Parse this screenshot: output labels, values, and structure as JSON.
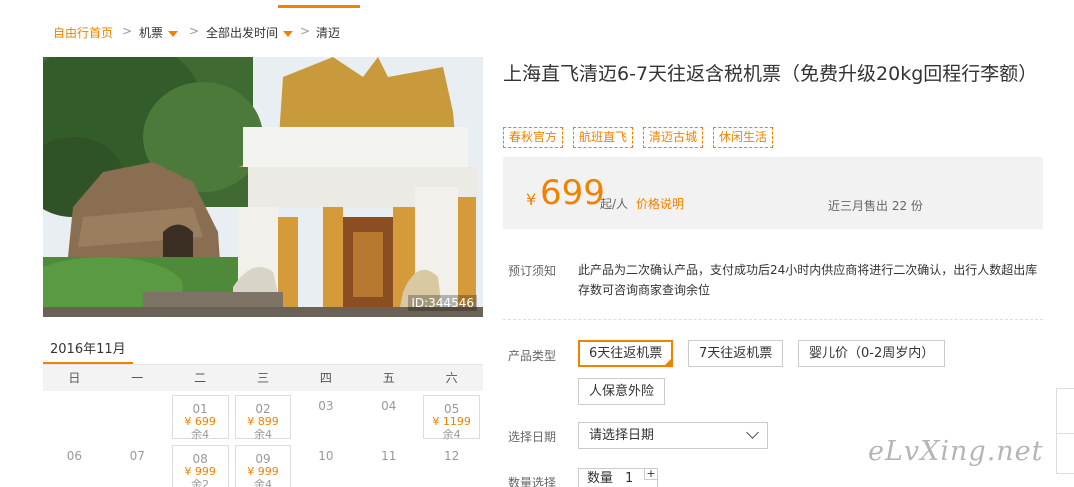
{
  "breadcrumb": {
    "home": "自由行首页",
    "flight": "机票",
    "departure": "全部出发时间",
    "destination": "清迈",
    "separator": ">"
  },
  "photo": {
    "id_label": "ID:344546"
  },
  "calendar": {
    "month": "2016年11月",
    "weekdays": [
      "日",
      "一",
      "二",
      "三",
      "四",
      "五",
      "六"
    ],
    "rows": [
      [
        {
          "day": ""
        },
        {
          "day": ""
        },
        {
          "day": "01",
          "price": "¥ 699",
          "stock": "余4"
        },
        {
          "day": "02",
          "price": "¥ 899",
          "stock": "余4"
        },
        {
          "day": "03"
        },
        {
          "day": "04"
        },
        {
          "day": "05",
          "price": "¥ 1199",
          "stock": "余4"
        }
      ],
      [
        {
          "day": "06"
        },
        {
          "day": "07"
        },
        {
          "day": "08",
          "price": "¥ 999",
          "stock": "余2"
        },
        {
          "day": "09",
          "price": "¥ 999",
          "stock": "余4"
        },
        {
          "day": "10"
        },
        {
          "day": "11"
        },
        {
          "day": "12"
        }
      ]
    ]
  },
  "product": {
    "title": "上海直飞清迈6-7天往返含税机票（免费升级20kg回程行李额）",
    "tags": [
      "春秋官方",
      "航班直飞",
      "清迈古城",
      "休闲生活"
    ],
    "currency": "¥",
    "price": "699",
    "price_unit": "起/人",
    "price_note": "价格说明",
    "sold": "近三月售出 22 份"
  },
  "booking": {
    "notice_label": "预订须知",
    "notice_text": "此产品为二次确认产品，支付成功后24小时内供应商将进行二次确认，出行人数超出库存数可咨询商家查询余位",
    "type_label": "产品类型",
    "types": [
      "6天往返机票",
      "7天往返机票",
      "婴儿价（0-2周岁内）",
      "人保意外险"
    ],
    "date_label": "选择日期",
    "date_placeholder": "请选择日期",
    "qty_label": "数量选择",
    "qty_prefix": "数量",
    "qty_value": "1",
    "plus": "+"
  },
  "watermark": "eLvXing.net",
  "colors": {
    "accent": "#f08200"
  }
}
